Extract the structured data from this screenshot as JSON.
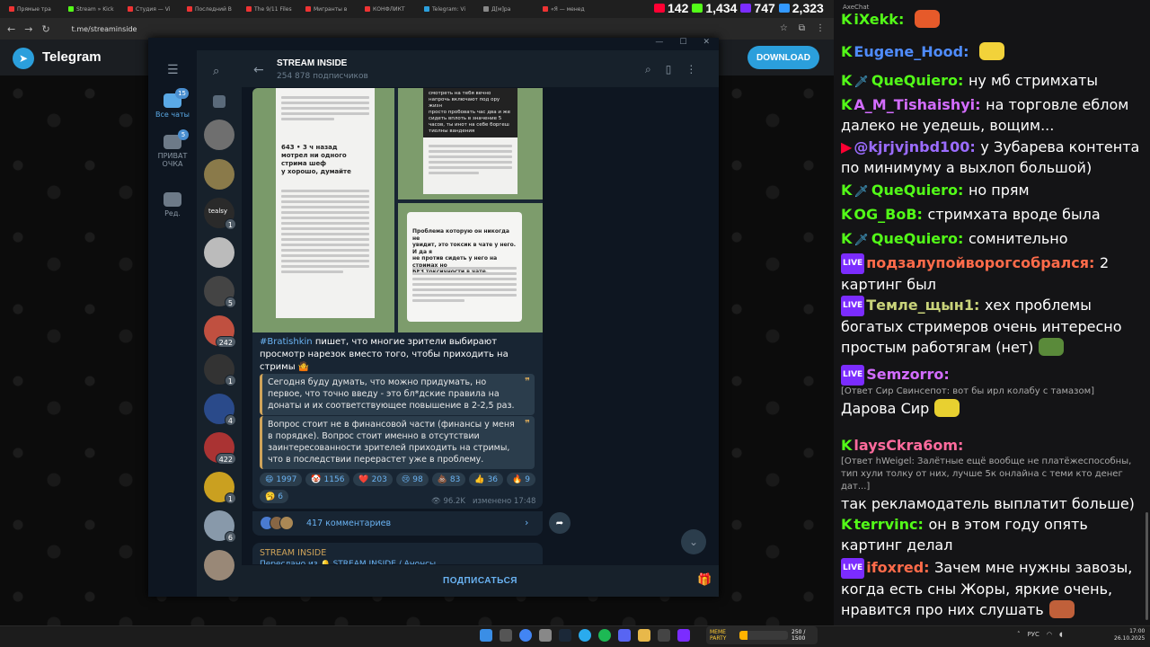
{
  "browser": {
    "tabs": [
      {
        "title": "Прямые тра",
        "color": "#e33"
      },
      {
        "title": "Stream » Kick",
        "color": "#53fc18"
      },
      {
        "title": "Студия — Vi",
        "color": "#e33"
      },
      {
        "title": "Последний В",
        "color": "#e33"
      },
      {
        "title": "The 9/11 Files",
        "color": "#e33"
      },
      {
        "title": "Мигранты в",
        "color": "#e33"
      },
      {
        "title": "КОНФЛИКТ",
        "color": "#e33"
      },
      {
        "title": "Telegram: Vi",
        "color": "#2b9fdc"
      },
      {
        "title": "Д[м]ра",
        "color": "#888"
      },
      {
        "title": "«Я — менед",
        "color": "#e33"
      }
    ],
    "url": "t.me/streaminside",
    "stats": [
      {
        "value": "142",
        "color": "#ff0033"
      },
      {
        "value": "1,434",
        "color": "#53fc18"
      },
      {
        "value": "747",
        "color": "#7b2cff"
      },
      {
        "value": "2,323",
        "color": "#3399ff"
      }
    ]
  },
  "web": {
    "brand": "Telegram",
    "download_label": "DOWNLOAD"
  },
  "telegram": {
    "rail": [
      {
        "label": "Все чаты",
        "badge": "15",
        "active": true
      },
      {
        "label": "ПРИВАТ ОЧКА",
        "badge": "5",
        "active": false
      },
      {
        "label": "Ред.",
        "badge": "",
        "active": false
      }
    ],
    "chat_avatars": [
      {
        "color": "#5a6a7a",
        "badge": ""
      },
      {
        "color": "#6f6f6f",
        "badge": ""
      },
      {
        "color": "#8a7a4a",
        "badge": ""
      },
      {
        "color": "#2a2a2a",
        "badge": "1",
        "text": "tealsy"
      },
      {
        "color": "#bbb",
        "badge": ""
      },
      {
        "color": "#444",
        "badge": "5"
      },
      {
        "color": "#c05040",
        "badge": "242"
      },
      {
        "color": "#333",
        "badge": "1"
      },
      {
        "color": "#2a4a8a",
        "badge": "4"
      },
      {
        "color": "#aa3333",
        "badge": "422"
      },
      {
        "color": "#caa020",
        "badge": "1"
      },
      {
        "color": "#8899aa",
        "badge": "6"
      },
      {
        "color": "#998877",
        "badge": ""
      }
    ],
    "channel": {
      "name": "STREAM INSIDE",
      "subscribers": "254 878 подписчиков"
    },
    "post": {
      "images": {
        "img1_lines": [
          "643 • 3 ч назад",
          "мотрел ни одного стрима шеф",
          "у хорошо, думайте"
        ],
        "img2_lines": [
          "смотреть на тебя вечно",
          "напрочь включают под ору жизн",
          "просто пробовать час два и же",
          "сидеть вплоть в значение 5",
          "часов, ты инот на себе боргеш",
          "тиолны вандения"
        ],
        "img3_lines": [
          "Проблема которую он никогда не",
          "увидит, это токсик в чате у него. И да я",
          "не против сидеть у него на стримах но",
          "БЕЗ токсичности в чате."
        ]
      },
      "hashtag": "#Bratishkin",
      "text": " пишет, что многие зрители выбирают просмотр нарезок вместо того, чтобы приходить на стримы 🤷",
      "quote1": "Сегодня буду думать, что можно придумать, но первое, что точно введу - это бл*дские правила на донаты и их соответствующее повышение в 2-2,5 раз.",
      "quote2": "Вопрос стоит не в финансовой части (финансы у меня в порядке). Вопрос стоит именно в отсутствии заинтересованности зрителей приходить на стримы, что в последствии перерастет уже в проблему.",
      "reactions": [
        {
          "emoji": "😄",
          "count": "1997"
        },
        {
          "emoji": "🤡",
          "count": "1156"
        },
        {
          "emoji": "❤️",
          "count": "203"
        },
        {
          "emoji": "😢",
          "count": "98"
        },
        {
          "emoji": "💩",
          "count": "83"
        },
        {
          "emoji": "👍",
          "count": "36"
        },
        {
          "emoji": "🔥",
          "count": "9"
        },
        {
          "emoji": "🥱",
          "count": "6"
        }
      ],
      "views": "96.2K",
      "edited": "изменено 17:48",
      "comments": "417 комментариев"
    },
    "next_post": {
      "name": "STREAM INSIDE",
      "forwarded": "Переслано из 🔔 STREAM INSIDE / Анонсы"
    },
    "subscribe_label": "ПОДПИСАТЬСЯ"
  },
  "chat": {
    "app": "AxeChat",
    "messages": [
      {
        "platform": "kick",
        "name": "iXekk",
        "color": "#53fc18",
        "text": "",
        "emote": "#e65a2a"
      },
      {
        "platform": "kick",
        "name": "Eugene_Hood",
        "color": "#4f8cff",
        "text": "",
        "emote": "#f2d23a"
      },
      {
        "platform": "kick",
        "name": "QueQuiero",
        "color": "#53fc18",
        "text": "ну мб стримхаты",
        "sword": true
      },
      {
        "platform": "kick",
        "name": "A_M_Tishaishyi",
        "color": "#d36cff",
        "text": "на торговле еблом далеко не уедешь, вощим..."
      },
      {
        "platform": "youtube",
        "name": "@kjrjvjnbd100",
        "color": "#9b6cff",
        "text": "у Зубарева контента по минимуму а выхлоп большой)"
      },
      {
        "platform": "kick",
        "name": "QueQuiero",
        "color": "#53fc18",
        "text": "но прям",
        "sword": true
      },
      {
        "platform": "kick",
        "name": "OG_BoB",
        "color": "#53fc18",
        "text": "стримхата вроде была"
      },
      {
        "platform": "kick",
        "name": "QueQuiero",
        "color": "#53fc18",
        "text": "сомнительно",
        "sword": true
      },
      {
        "platform": "vk",
        "name": "подзалупойворогсобрался",
        "color": "#ff6b4a",
        "text": "2 картинг был"
      },
      {
        "platform": "vk",
        "name": "Темле_щын1",
        "color": "#c9d37a",
        "text": "хех проблемы богатых стримеров очень интересно простым работягам (нет)",
        "emote": "#5a8a3a"
      },
      {
        "platform": "vk",
        "name": "Semzorro",
        "color": "#d36cff",
        "reply": "[Ответ Сир Свинсепот: вот бы ирл колабу с тамазом]",
        "text": "Дарова Сир",
        "emote": "#e8d030"
      },
      {
        "platform": "kick",
        "name": "laysCkra6om",
        "color": "#ff6b9d",
        "reply": "[Ответ hWeigel: Залётные ещё вообще не платёжеспособны, тип хули толку от них, лучше 5к онлайна с теми кто денег дат...]",
        "text": "так рекламодатель выплатит больше)"
      },
      {
        "platform": "kick",
        "name": "terrvinc",
        "color": "#53fc18",
        "text": "он в этом году опять картинг делал"
      },
      {
        "platform": "vk",
        "name": "ifoxred",
        "color": "#ff6b4a",
        "text": "Зачем мне нужны завозы, когда есть сны Жоры, яркие очень, нравится про них слушать",
        "emote": "#c0603a"
      }
    ]
  },
  "taskbar": {
    "meme_title": "MEME PARTY",
    "meme_progress": "250 / 1500",
    "meme_progress_fraction": 0.167,
    "lang": "РУС",
    "time": "17:00",
    "date": "26.10.2025"
  }
}
